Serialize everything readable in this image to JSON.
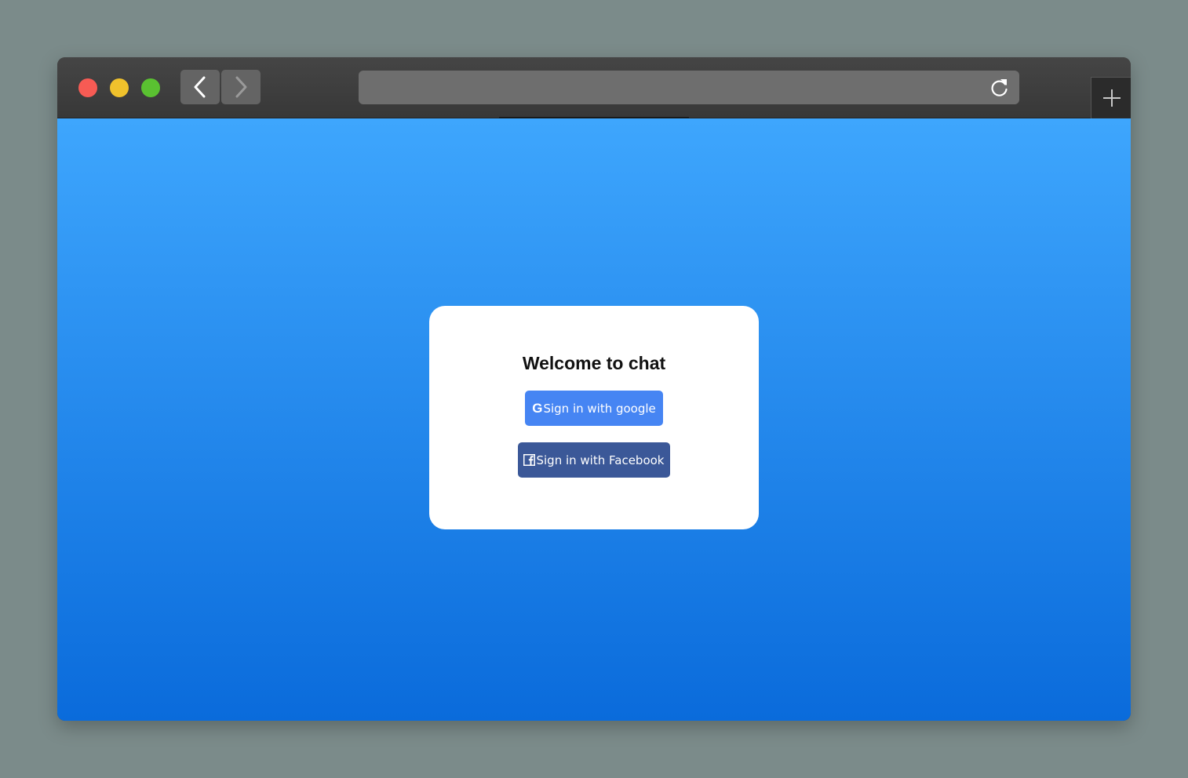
{
  "browser": {
    "traffic_lights": {
      "close_color": "#f75b54",
      "minimize_color": "#f0c22c",
      "maximize_color": "#5ac131"
    },
    "nav": {
      "back_icon": "chevron-left-icon",
      "forward_icon": "chevron-right-icon"
    },
    "address_bar": {
      "value": "",
      "reload_icon": "reload-icon"
    },
    "new_tab_icon": "plus-icon"
  },
  "page": {
    "background_gradient": [
      "#3ea6fd",
      "#0a6bdb"
    ],
    "card": {
      "title": "Welcome to chat",
      "google_button": {
        "icon_glyph": "G",
        "icon": "google-icon",
        "label": "Sign in with google",
        "color": "#4685f3"
      },
      "facebook_button": {
        "icon": "facebook-icon",
        "label": "Sign in with Facebook",
        "color": "#3b5898"
      }
    }
  }
}
